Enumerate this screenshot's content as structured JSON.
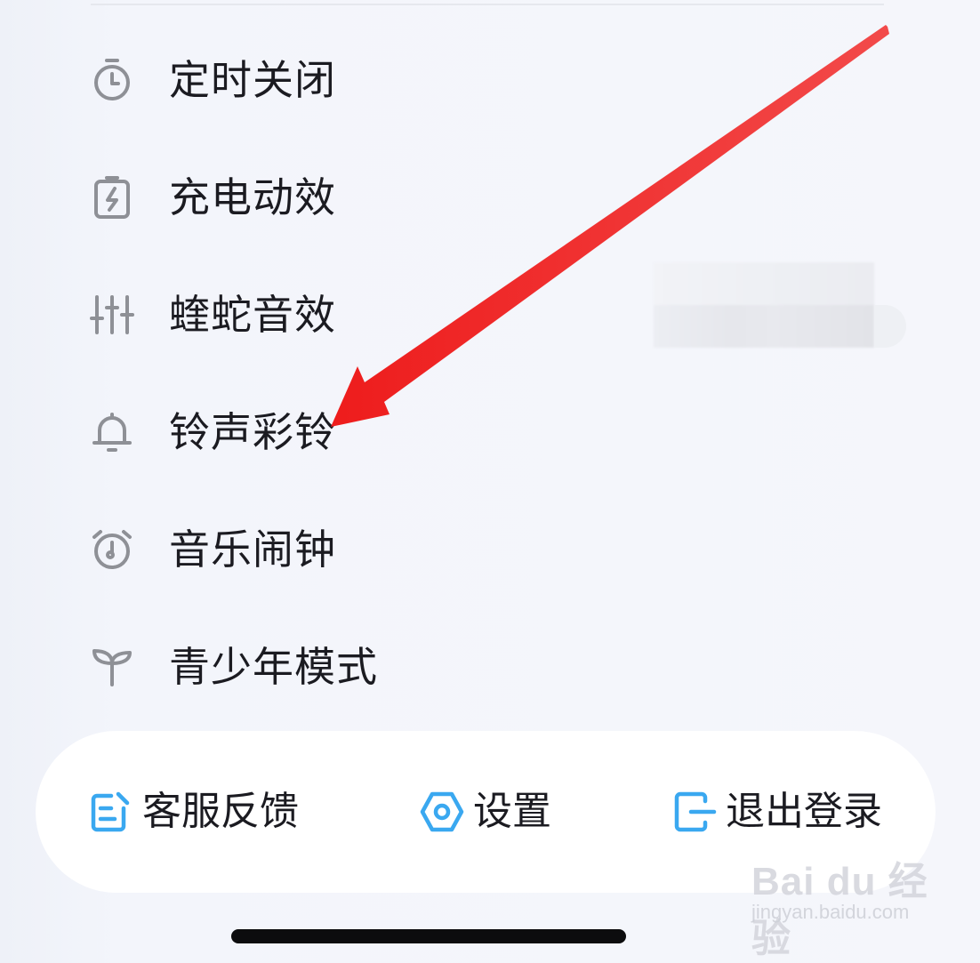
{
  "menu": {
    "items": [
      {
        "label": "定时关闭",
        "icon": "timer-icon"
      },
      {
        "label": "充电动效",
        "icon": "charging-battery-icon"
      },
      {
        "label": "蝰蛇音效",
        "icon": "equalizer-icon"
      },
      {
        "label": "铃声彩铃",
        "icon": "bell-icon"
      },
      {
        "label": "音乐闹钟",
        "icon": "alarm-clock-icon"
      },
      {
        "label": "青少年模式",
        "icon": "sprout-icon"
      }
    ]
  },
  "bottom_bar": {
    "feedback_label": "客服反馈",
    "settings_label": "设置",
    "logout_label": "退出登录"
  },
  "watermark": {
    "brand": "Bai du 经验",
    "url": "jingyan.baidu.com"
  },
  "colors": {
    "background": "#f5f6fb",
    "icon_gray": "#8e9096",
    "accent_blue": "#3aa8f0",
    "annotation_red": "#ee1c1c",
    "text": "#1b1b21"
  }
}
